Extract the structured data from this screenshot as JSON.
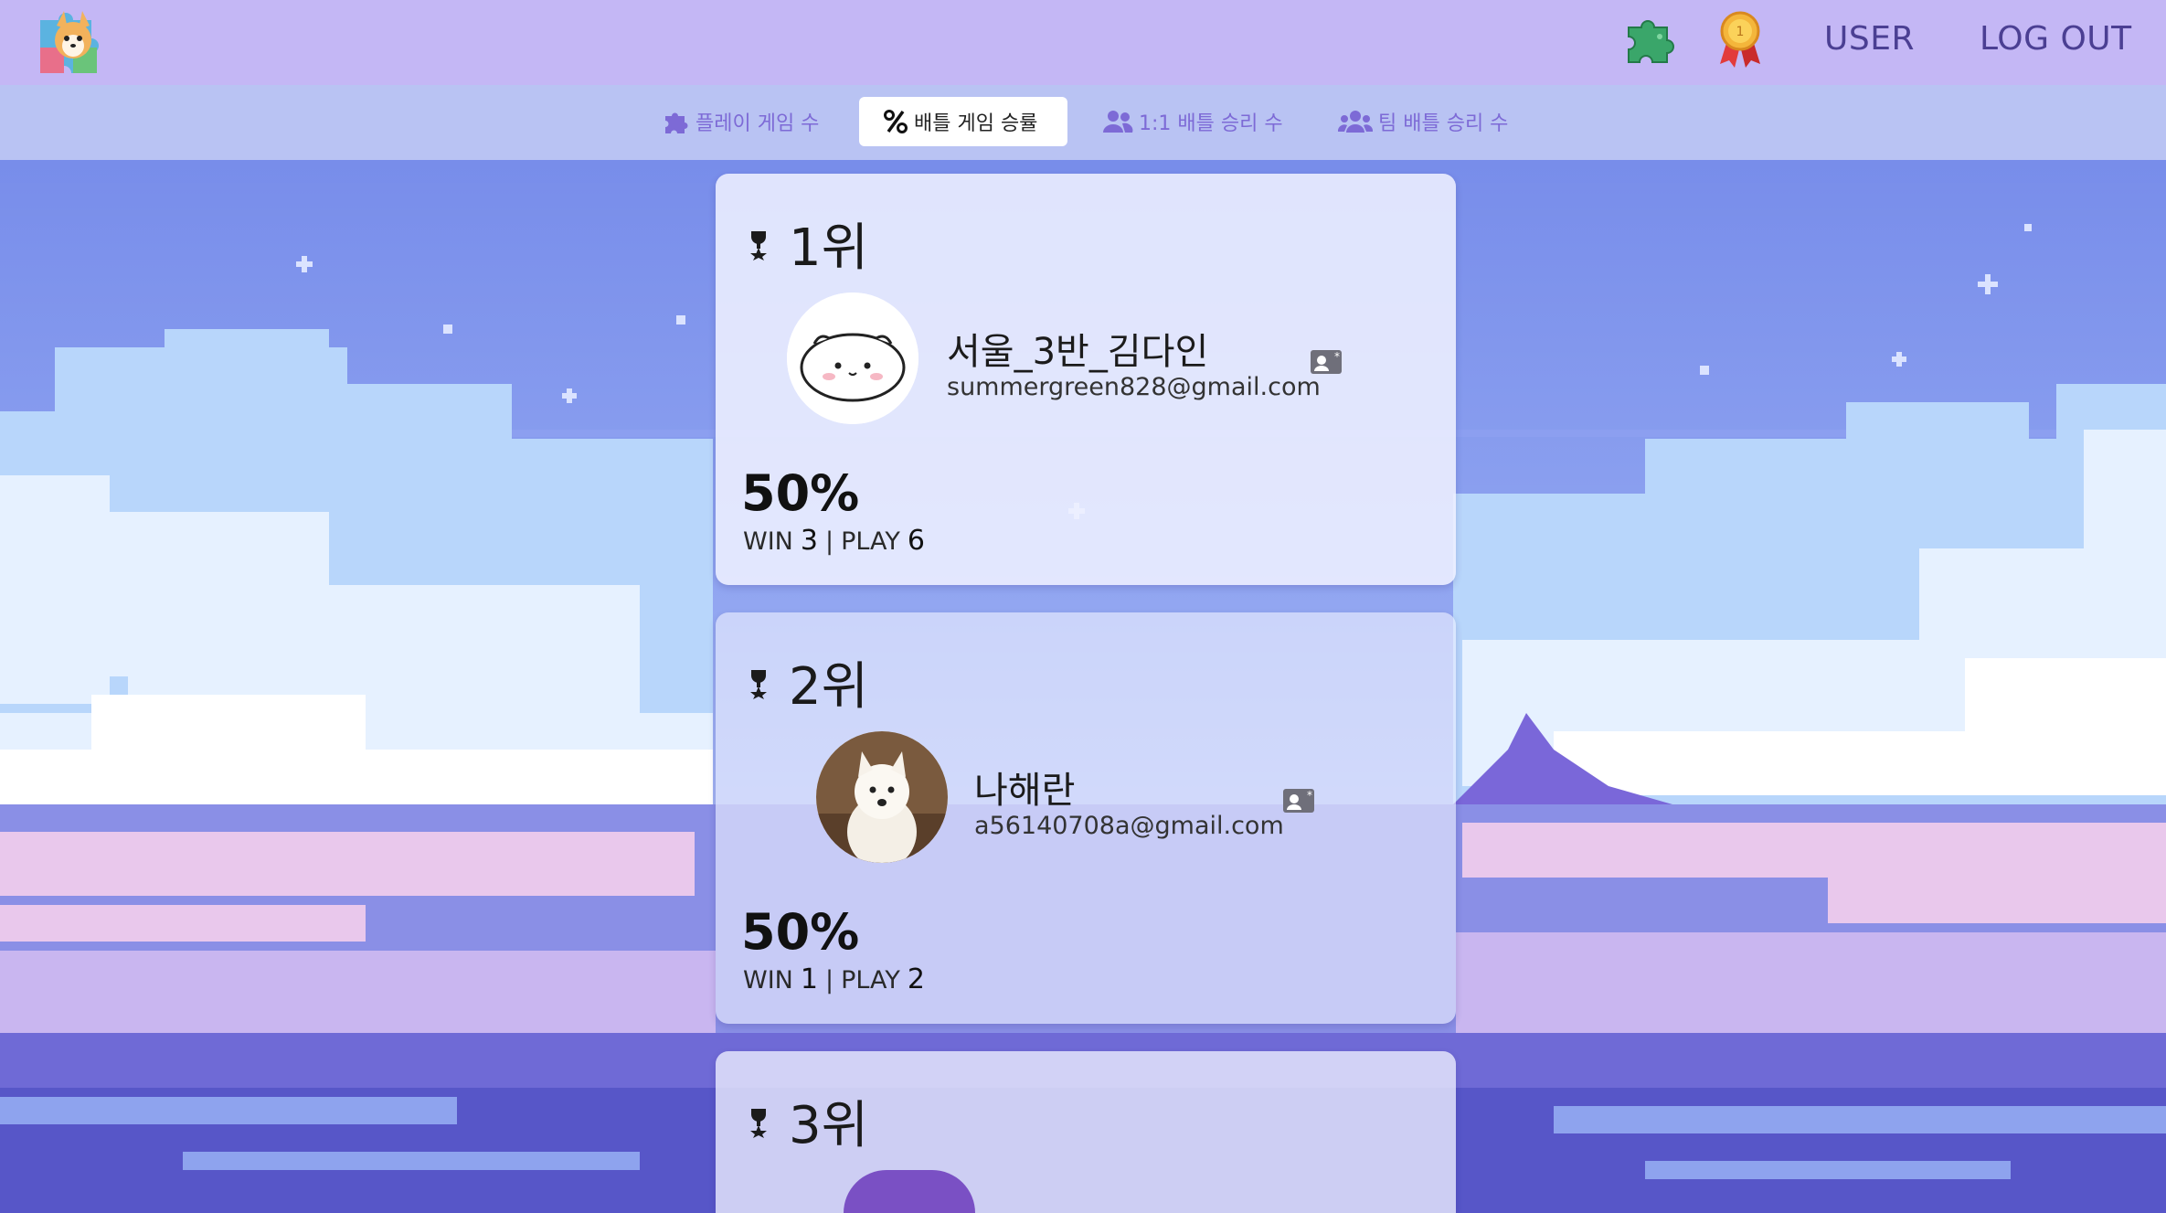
{
  "header": {
    "nav": {
      "user": "USER",
      "logout": "LOG OUT"
    }
  },
  "tabs": [
    {
      "label": "플레이 게임 수",
      "icon": "puzzle-icon",
      "active": false
    },
    {
      "label": "배틀 게임 승률",
      "icon": "percent-icon",
      "active": true
    },
    {
      "label": "1:1 배틀 승리 수",
      "icon": "users-icon",
      "active": false
    },
    {
      "label": "팀 배틀 승리 수",
      "icon": "group-icon",
      "active": false
    }
  ],
  "ranking": [
    {
      "rank": "1위",
      "name": "서울_3반_김다인",
      "email": "summergreen828@gmail.com",
      "win_rate": "50%",
      "win_label": "WIN",
      "wins": "3",
      "separator": "|",
      "play_label": "PLAY",
      "plays": "6"
    },
    {
      "rank": "2위",
      "name": "나해란",
      "email": "a56140708a@gmail.com",
      "win_rate": "50%",
      "win_label": "WIN",
      "wins": "1",
      "separator": "|",
      "play_label": "PLAY",
      "plays": "2"
    },
    {
      "rank": "3위"
    }
  ],
  "colors": {
    "header_bg": "#c4b7f5",
    "tab_bar_bg": "#b9c3f3",
    "accent_purple": "#7d6ad6",
    "nav_text": "#4b3f93"
  }
}
